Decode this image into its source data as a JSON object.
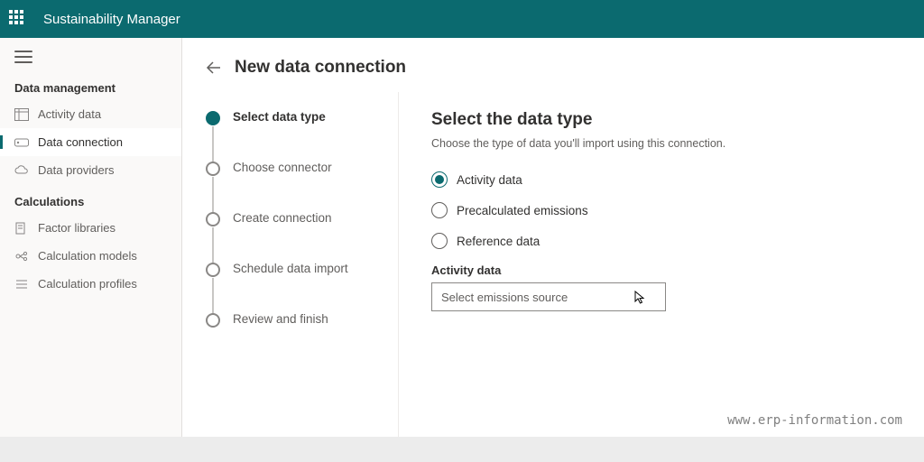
{
  "app_title": "Sustainability Manager",
  "sidebar": {
    "sections": [
      {
        "title": "Data management",
        "items": [
          {
            "label": "Activity data",
            "icon": "table-icon"
          },
          {
            "label": "Data connection",
            "icon": "link-icon",
            "selected": true
          },
          {
            "label": "Data providers",
            "icon": "cloud-icon"
          }
        ]
      },
      {
        "title": "Calculations",
        "items": [
          {
            "label": "Factor libraries",
            "icon": "doc-icon"
          },
          {
            "label": "Calculation models",
            "icon": "model-icon"
          },
          {
            "label": "Calculation profiles",
            "icon": "list-icon"
          }
        ]
      }
    ]
  },
  "page": {
    "title": "New data connection"
  },
  "steps": [
    {
      "label": "Select data type",
      "active": true
    },
    {
      "label": "Choose connector"
    },
    {
      "label": "Create connection"
    },
    {
      "label": "Schedule data import"
    },
    {
      "label": "Review and finish"
    }
  ],
  "panel": {
    "title": "Select the data type",
    "description": "Choose the type of data you'll import using this connection.",
    "options": [
      {
        "label": "Activity data",
        "selected": true
      },
      {
        "label": "Precalculated emissions"
      },
      {
        "label": "Reference data"
      }
    ],
    "field_label": "Activity data",
    "select_placeholder": "Select emissions source"
  },
  "watermark": "www.erp-information.com"
}
